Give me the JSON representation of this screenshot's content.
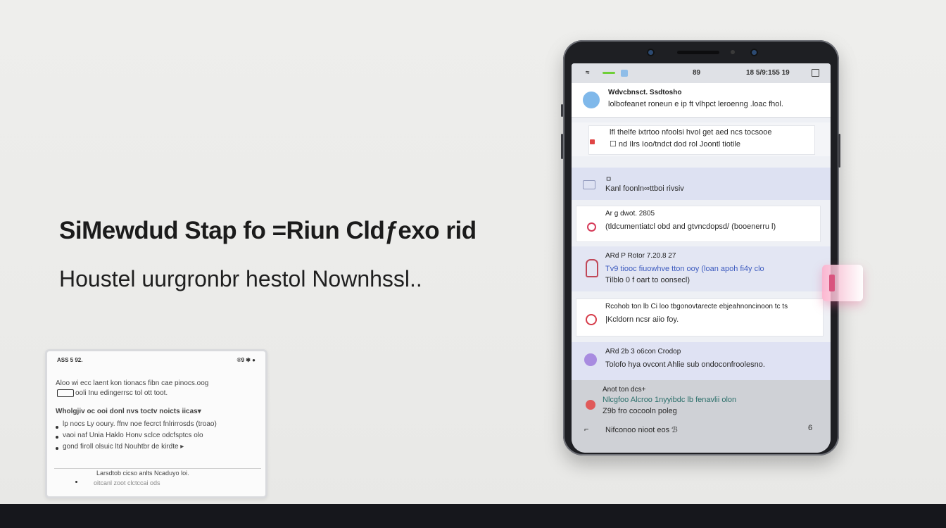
{
  "headline": "SiMewdud Stap fo =Riun Cldƒexo rid",
  "subhead": "Houstel uurgronbr hestol Nownhssl..",
  "tablet": {
    "status_left": "ASS 5 92.",
    "status_right": "®9 ✱ ●",
    "line1": "Aloo wi ecc laent kon tionacs fibn cae pinocs.oog",
    "line2": "ooli Inu edingerrsc tol ott toot.",
    "line3": "Wholgjiv oc ooi donl nvs toctv noicts iicas▾",
    "line4": "lp nocs Ly ooury. ffnv noe fecrct fnlrirrosds (troao)",
    "line5": "vaoi naf Unia Haklo Honv sclce odcfsptcs olo",
    "line6": "gond firoll olsuic ltd Nouhtbr de kirdte ▸",
    "line7": "Larsdtob cicso anlts Ncaduyo loi.",
    "line8": "oitcanl zoot clctccai ods"
  },
  "phone": {
    "status_center": "89",
    "status_right": "18 5/9:155 19",
    "rows": [
      {
        "title": "Wdvcbnsct. Ssdtosho",
        "line": "lolbofeanet roneun e ip ft vlhpct leroenng .loac fhol.",
        "icon_color": "#7fb8ea"
      },
      {
        "title": "",
        "line": "lfl thelfe ixtrtoo nfoolsi hvol get aed ncs tocsooe",
        "line2": "☐ nd Ilrs Ioo/tndct dod rol Joontl tiotile",
        "icon_color": "#e04545"
      },
      {
        "title": "ㅁ",
        "line": "Kanl foonln∞ttboi rivsiv",
        "icon_color": "#9aa3c2"
      },
      {
        "title": "Ar g dwot. 2805",
        "line": "(tldcumentiatcl obd and gtvncdopsd/ (booenerru l)",
        "icon_color": "#d63c5a"
      },
      {
        "title": "ARd P Rotor 7.20.8 27",
        "line": "Tv9 tiooc fiuowhve tton ooy  (loan apoh fi4y clo",
        "line2": "Tilblo  0 f oart to oonsecl)",
        "icon_color": "#c04858"
      },
      {
        "title": "Rcohob ton lb Ci loo tbgonovtarecte ebjeahnoncinoon tc ts",
        "line": "|Kcldorn ncsr aiio foy.",
        "icon_color": "#d63c4a"
      },
      {
        "title": "ARd 2b 3 o6con Crodop",
        "line": "Tolofo hya ovcont Ahlie sub ondoconfroolesno.",
        "icon_color": "#a88be0"
      },
      {
        "title": "Anot ton dcs+",
        "line": "Nlcgfoo Alcroo 1nyyibdc lb fenavlii olon",
        "line2": "Z9b fro cocooln poleg",
        "icon_color": "#e05a5a"
      }
    ],
    "nav_left": "⌐",
    "nav_center": "Nifconoo nioot eos ℬ",
    "nav_right": "6"
  }
}
